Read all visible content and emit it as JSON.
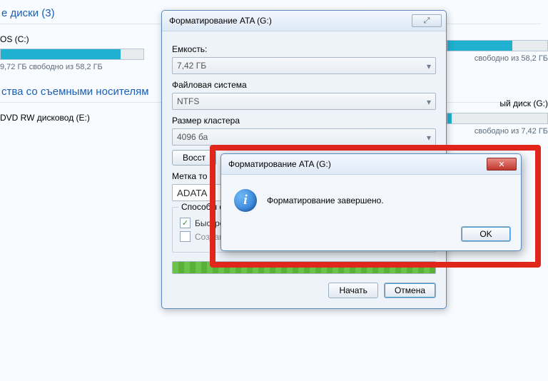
{
  "explorer": {
    "disks_header": "е диски (3)",
    "drive_c": {
      "name": "OS (C:)",
      "stat": "9,72 ГБ свободно из 58,2 ГБ",
      "fill_pct": 84
    },
    "removable_header": "ства со съемными носителям",
    "drive_e": {
      "name": "DVD RW дисковод (E:)"
    },
    "right1": {
      "stat": "свободно из 58,2 ГБ",
      "fill_pct": 65
    },
    "right2": {
      "title": "ый диск (G:)",
      "stat": "свободно из 7,42 ГБ",
      "fill_pct": 4
    }
  },
  "format": {
    "title": "Форматирование ATA (G:)",
    "glyph_close": "⤢",
    "capacity_label": "Емкость:",
    "capacity_value": "7,42 ГБ",
    "fs_label": "Файловая система",
    "fs_value": "NTFS",
    "cluster_label": "Размер кластера",
    "cluster_value": "4096 ба",
    "restore_btn": "Восст",
    "volume_label": "Метка то",
    "volume_value": "ADATA",
    "group_legend": "Способы форматирования:",
    "chk_quick": "Быстрое (очистка оглавления)",
    "chk_msdos": "Создание загрузочного диска MS-DOS",
    "start_btn": "Начать",
    "cancel_btn": "Отмена",
    "dd_arrow": "▾"
  },
  "msg": {
    "title": "Форматирование ATA (G:)",
    "glyph_close": "✕",
    "text": "Форматирование завершено.",
    "ok": "OK"
  }
}
